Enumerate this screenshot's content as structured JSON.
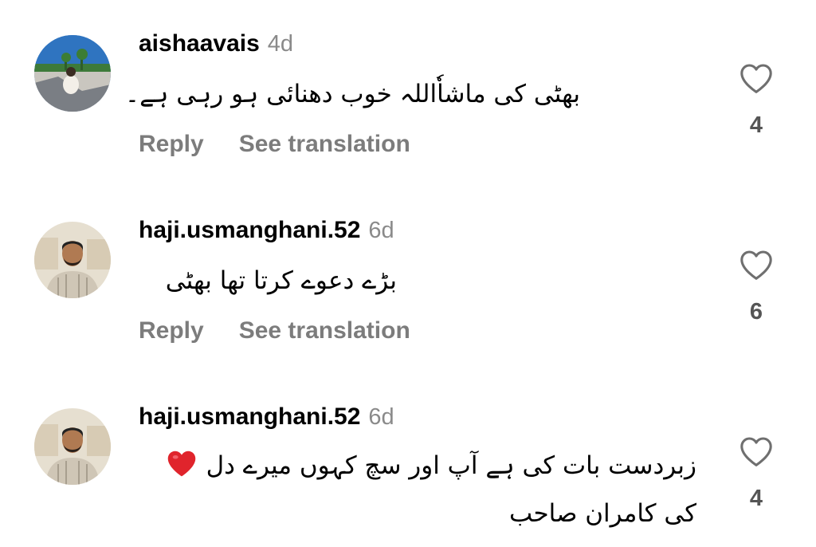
{
  "comments": [
    {
      "username": "aishaavais",
      "time": "4d",
      "text": "بھٹی کی ماشاٗاللہ خوب دھنائی ہو رہی ہے۔",
      "reply_label": "Reply",
      "translate_label": "See translation",
      "likes": "4",
      "avatar": "photo-person-on-boat"
    },
    {
      "username": "haji.usmanghani.52",
      "time": "6d",
      "text": "بڑے دعوے کرتا تھا بھٹی",
      "reply_label": "Reply",
      "translate_label": "See translation",
      "likes": "6",
      "avatar": "photo-man-portrait"
    },
    {
      "username": "haji.usmanghani.52",
      "time": "6d",
      "text_line1": "زبردست بات کی ہے آپ اور سچ کہوں میرے دل",
      "text_line2": "کی کامران صاحب",
      "emoji": "red-heart",
      "likes": "4",
      "avatar": "photo-man-portrait"
    }
  ],
  "colors": {
    "username": "#000000",
    "meta": "#8a8a8a",
    "action": "#7c7c7c",
    "heart_emoji": "#e0242c"
  }
}
